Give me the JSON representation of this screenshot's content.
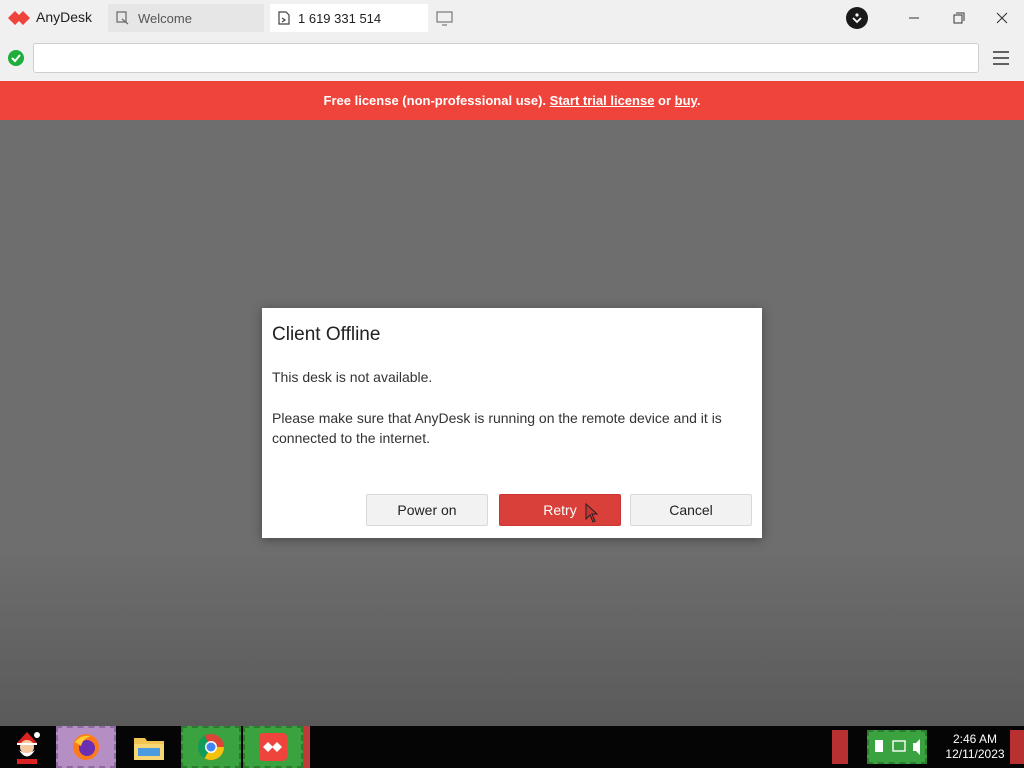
{
  "app": {
    "name": "AnyDesk"
  },
  "tabs": [
    {
      "label": "Welcome"
    },
    {
      "label": "1 619 331 514"
    }
  ],
  "address": {
    "value": ""
  },
  "banner": {
    "prefix": "Free license (non-professional use). ",
    "trial_link": "Start trial license",
    "middle": " or ",
    "buy_link": "buy",
    "suffix": "."
  },
  "dialog": {
    "title": "Client Offline",
    "line1": "This desk is not available.",
    "line2": "Please make sure that AnyDesk is running on the remote device and it is connected to the internet.",
    "buttons": {
      "power_on": "Power on",
      "retry": "Retry",
      "cancel": "Cancel"
    }
  },
  "taskbar": {
    "time": "2:46 AM",
    "date": "12/11/2023"
  },
  "colors": {
    "brand_red": "#ef443b",
    "retry_red": "#d9403a",
    "status_green": "#1fae3b"
  },
  "icons": [
    "anydesk-logo-icon",
    "welcome-tab-icon",
    "remote-tab-icon",
    "new-tab-icon",
    "download-icon",
    "minimize-icon",
    "maximize-icon",
    "close-icon",
    "connection-ok-icon",
    "menu-icon",
    "santa-icon",
    "firefox-icon",
    "file-explorer-icon",
    "chrome-icon",
    "anydesk-taskbar-icon",
    "volume-icon"
  ]
}
